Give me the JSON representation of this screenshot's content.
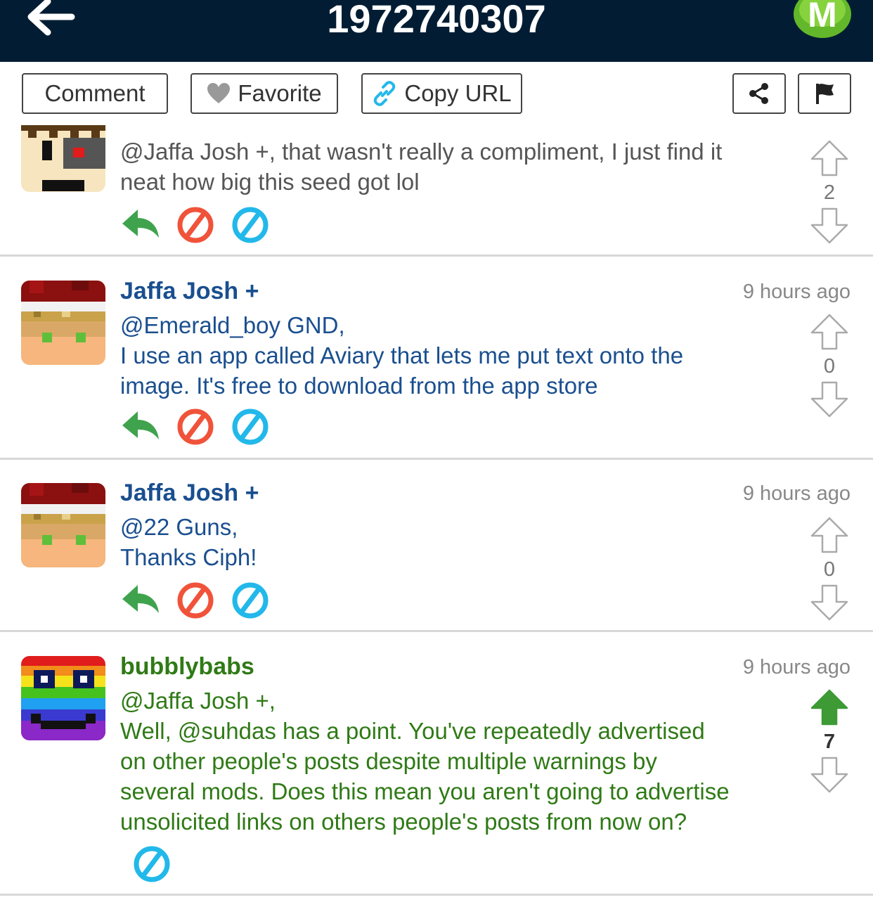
{
  "header": {
    "title": "1972740307",
    "logo_letter": "M"
  },
  "toolbar": {
    "comment_label": "Comment",
    "favorite_label": "Favorite",
    "copy_url_label": "Copy URL"
  },
  "colors": {
    "header_bg": "#021d33",
    "reply_green": "#3fa34d",
    "ban_red": "#f0533a",
    "ignore_cyan": "#22b8ea",
    "upvoted_green": "#3d9a35",
    "mod_name_blue": "#1a4f8f",
    "user_name_green": "#2f7a16"
  },
  "comments": [
    {
      "author": "",
      "time": "",
      "lines": [
        "@Jaffa Josh +, that wasn't really a compliment, I just find it",
        "neat how big this seed got lol"
      ],
      "score": "2"
    },
    {
      "author": "Jaffa Josh +",
      "time": "9 hours ago",
      "lines": [
        "@Emerald_boy GND,",
        "I use an app called Aviary that lets me put text onto the",
        "image. It's free to download from the app store"
      ],
      "score": "0"
    },
    {
      "author": "Jaffa Josh +",
      "time": "9 hours ago",
      "lines": [
        "@22 Guns,",
        "Thanks Ciph!"
      ],
      "score": "0"
    },
    {
      "author": "bubblybabs",
      "time": "9 hours ago",
      "lines": [
        "@Jaffa Josh +,",
        "Well, @suhdas has a point. You've repeatedly advertised",
        "on other people's posts despite multiple warnings by",
        "several mods. Does this mean you aren't going to advertise",
        "unsolicited links on others people's posts from now on?"
      ],
      "score": "7"
    }
  ]
}
